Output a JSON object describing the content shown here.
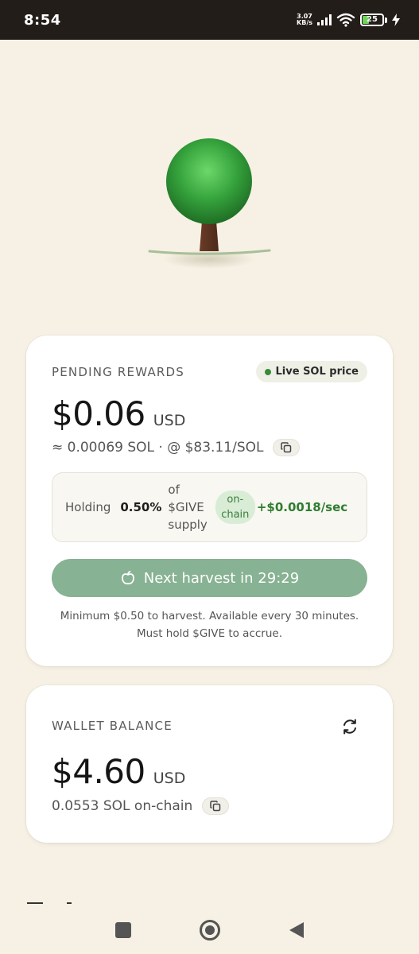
{
  "status_bar": {
    "time": "8:54",
    "net_speed_value": "3.07",
    "net_speed_unit": "KB/s",
    "battery_level": "25"
  },
  "rewards": {
    "label": "PENDING REWARDS",
    "live_badge": "Live SOL price",
    "amount": "$0.06",
    "currency": "USD",
    "sol_line": "≈ 0.00069 SOL · @ $83.11/SOL",
    "holding_label": "Holding",
    "holding_pct": "0.50%",
    "supply_line1": "of",
    "supply_line2": "$GIVE",
    "supply_line3": "supply",
    "onchain_line1": "on-",
    "onchain_line2": "chain",
    "rate": "+$0.0018/sec",
    "harvest_button": "Next harvest in 29:29",
    "footnote_line1": "Minimum $0.50 to harvest. Available every 30 minutes.",
    "footnote_line2": "Must hold $GIVE to accrue."
  },
  "wallet": {
    "label": "WALLET BALANCE",
    "amount": "$4.60",
    "currency": "USD",
    "sol_line": "0.0553 SOL on-chain"
  },
  "colors": {
    "background": "#f6f1e4",
    "accent_green": "#87b293",
    "rate_green": "#2f7d32",
    "status_bar": "#231d19"
  }
}
